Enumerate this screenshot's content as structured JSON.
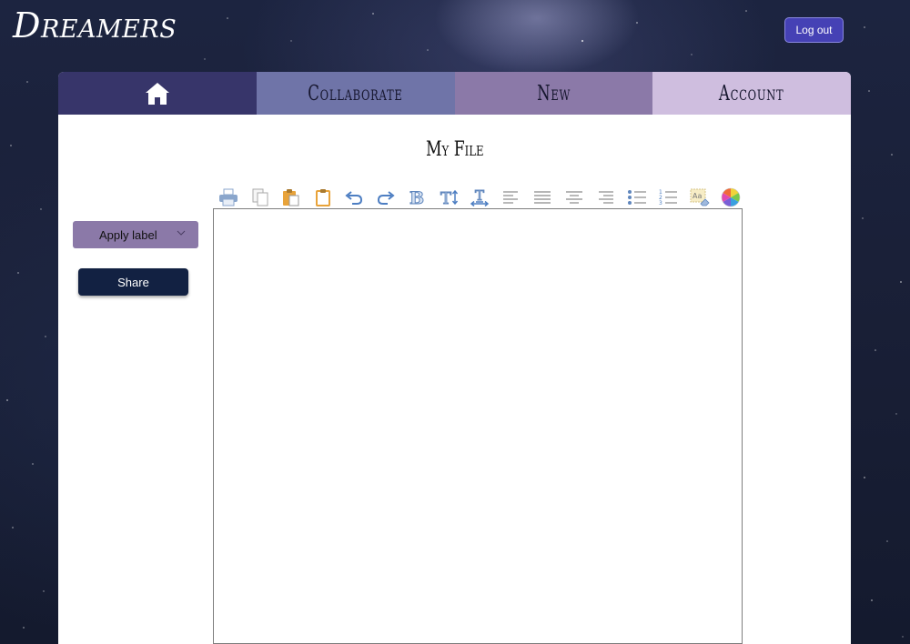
{
  "app": {
    "brand": "Dreamers",
    "logout_label": "Log out"
  },
  "tabs": [
    {
      "label": "",
      "icon": "home-icon"
    },
    {
      "label": "Collaborate"
    },
    {
      "label": "New"
    },
    {
      "label": "Account"
    }
  ],
  "file": {
    "title": "My File"
  },
  "sidebar": {
    "apply_label": "Apply label",
    "share_label": "Share"
  },
  "toolbar": {
    "icons": [
      "print-icon",
      "copy-icon",
      "paste-icon",
      "paste-text-icon",
      "undo-icon",
      "redo-icon",
      "bold-icon",
      "font-size-icon",
      "letter-spacing-icon",
      "align-left-icon",
      "justify-icon",
      "align-center-icon",
      "align-right-icon",
      "bullet-list-icon",
      "numbered-list-icon",
      "clear-format-icon",
      "color-picker-icon"
    ]
  },
  "colors": {
    "tab_home": "#37356a",
    "tab_collaborate": "#6f74a8",
    "tab_new": "#8b79a8",
    "tab_account": "#cfbedf",
    "logout_button": "#4541b5",
    "share_button": "#122142",
    "icon_blue": "#6a8fc2",
    "icon_orange": "#e8a33a"
  }
}
